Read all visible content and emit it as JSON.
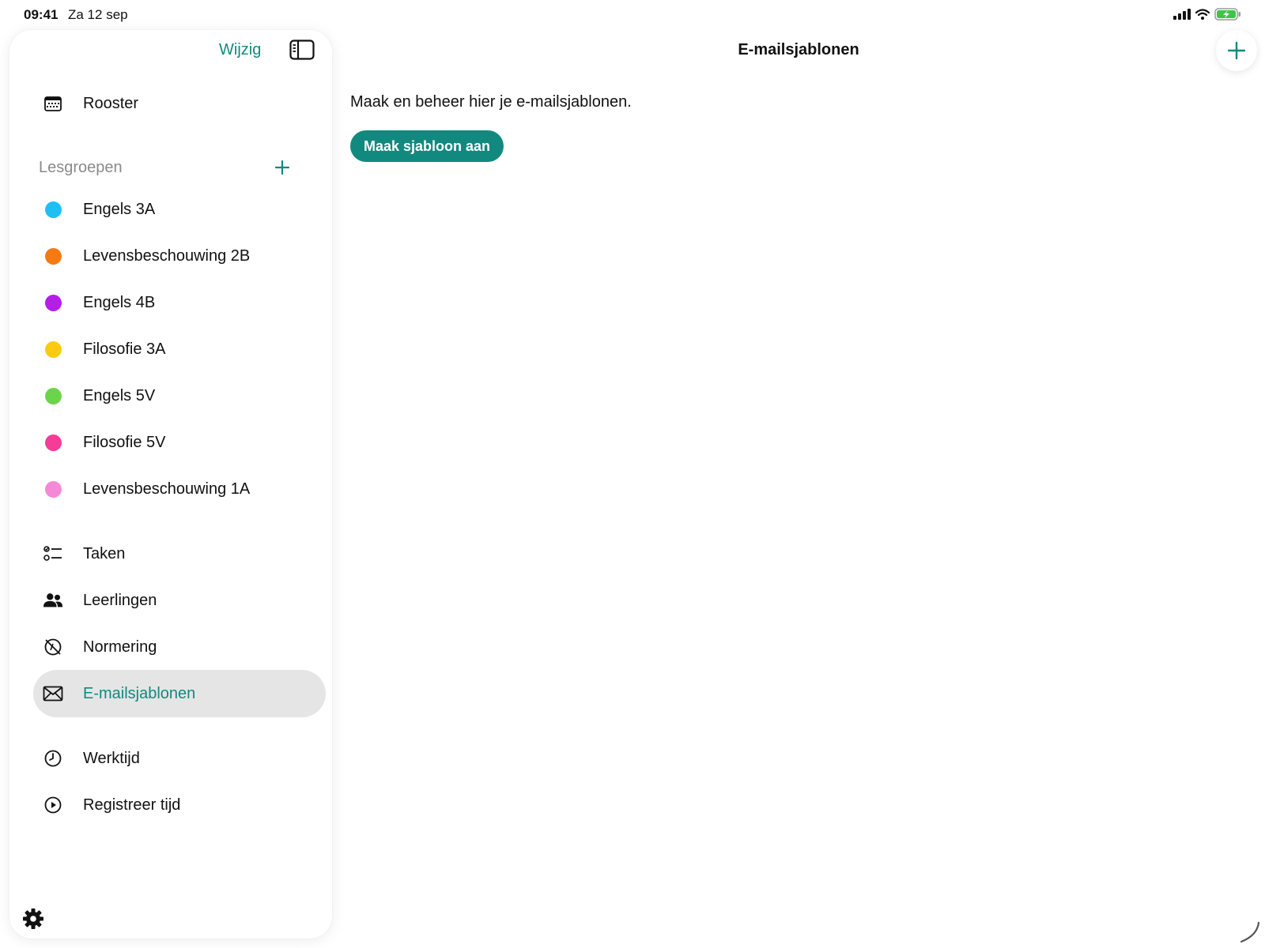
{
  "status_bar": {
    "time": "09:41",
    "date": "Za 12 sep"
  },
  "sidebar": {
    "edit_label": "Wijzig",
    "primary_items": [
      {
        "label": "Rooster",
        "icon": "calendar-icon"
      }
    ],
    "groups_section": {
      "title": "Lesgroepen",
      "groups": [
        {
          "label": "Engels 3A",
          "color": "#1ebff5"
        },
        {
          "label": "Levensbeschouwing 2B",
          "color": "#f57a14"
        },
        {
          "label": "Engels 4B",
          "color": "#b41fe6"
        },
        {
          "label": "Filosofie 3A",
          "color": "#fccb0f"
        },
        {
          "label": "Engels 5V",
          "color": "#6cd44b"
        },
        {
          "label": "Filosofie 5V",
          "color": "#f53c97"
        },
        {
          "label": "Levensbeschouwing 1A",
          "color": "#f589d8"
        }
      ]
    },
    "tool_items": [
      {
        "label": "Taken",
        "icon": "checklist-icon"
      },
      {
        "label": "Leerlingen",
        "icon": "people-icon"
      },
      {
        "label": "Normering",
        "icon": "rating-icon"
      },
      {
        "label": "E-mailsjablonen",
        "icon": "envelope-icon",
        "active": true
      }
    ],
    "time_items": [
      {
        "label": "Werktijd",
        "icon": "clock-icon"
      },
      {
        "label": "Registreer tijd",
        "icon": "play-circle-icon"
      }
    ]
  },
  "main": {
    "title": "E-mailsjablonen",
    "intro": "Maak en beheer hier je e-mailsjablonen.",
    "create_button_label": "Maak sjabloon aan"
  },
  "colors": {
    "accent": "#11897f",
    "active_background": "#e5e5e5"
  }
}
